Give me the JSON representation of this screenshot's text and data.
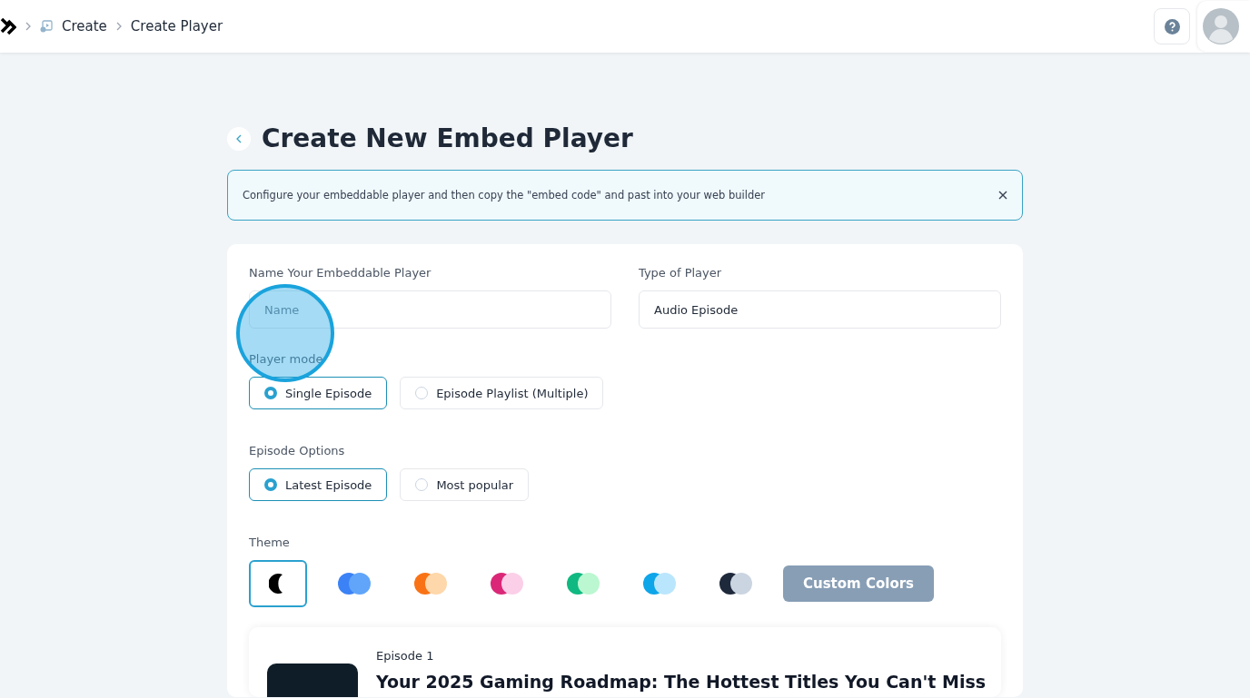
{
  "breadcrumb": [
    {
      "label": "Create",
      "kind": "player-icon"
    },
    {
      "label": "Create Player",
      "kind": "plain"
    }
  ],
  "page_title": "Create New Embed Player",
  "notice": "Configure your embeddable player and then copy the \"embed code\" and past into your web builder",
  "fields": [
    {
      "label": "Name Your Embeddable Player",
      "placeholder": "Name"
    },
    {
      "label": "Type of Player",
      "value": "Audio Episode"
    }
  ],
  "groups": [
    {
      "label": "Player mode",
      "options": [
        {
          "label": "Single Episode",
          "selected": true
        },
        {
          "label": "Episode Playlist (Multiple)",
          "selected": false
        }
      ]
    },
    {
      "label": "Episode Options",
      "options": [
        {
          "label": "Latest Episode",
          "selected": true
        },
        {
          "label": "Most popular",
          "selected": false
        }
      ]
    }
  ],
  "theme": {
    "label": "Theme",
    "swatches": [
      {
        "kind": "moon",
        "dots": [
          {
            "color": "#000000"
          }
        ],
        "selected": true
      },
      {
        "kind": "pair",
        "dots": [
          {
            "color": "#3b82f6"
          },
          {
            "color": "#60a5fa"
          }
        ],
        "selected": false
      },
      {
        "kind": "pair",
        "dots": [
          {
            "color": "#f97316"
          },
          {
            "color": "#fed7aa"
          }
        ],
        "selected": false
      },
      {
        "kind": "pair",
        "dots": [
          {
            "color": "#db2777"
          },
          {
            "color": "#fbcfe8"
          }
        ],
        "selected": false
      },
      {
        "kind": "pair",
        "dots": [
          {
            "color": "#10b981"
          },
          {
            "color": "#bbf7d0"
          }
        ],
        "selected": false
      },
      {
        "kind": "pair",
        "dots": [
          {
            "color": "#0ea5e9"
          },
          {
            "color": "#bae6fd"
          }
        ],
        "selected": false
      },
      {
        "kind": "pair",
        "dots": [
          {
            "color": "#1e293b"
          },
          {
            "color": "#cbd5e1"
          }
        ],
        "selected": false
      }
    ],
    "custom_button": "Custom Colors"
  },
  "preview": {
    "episode": "Episode 1",
    "title": "Your 2025 Gaming Roadmap: The Hottest Titles You Can't Miss"
  }
}
